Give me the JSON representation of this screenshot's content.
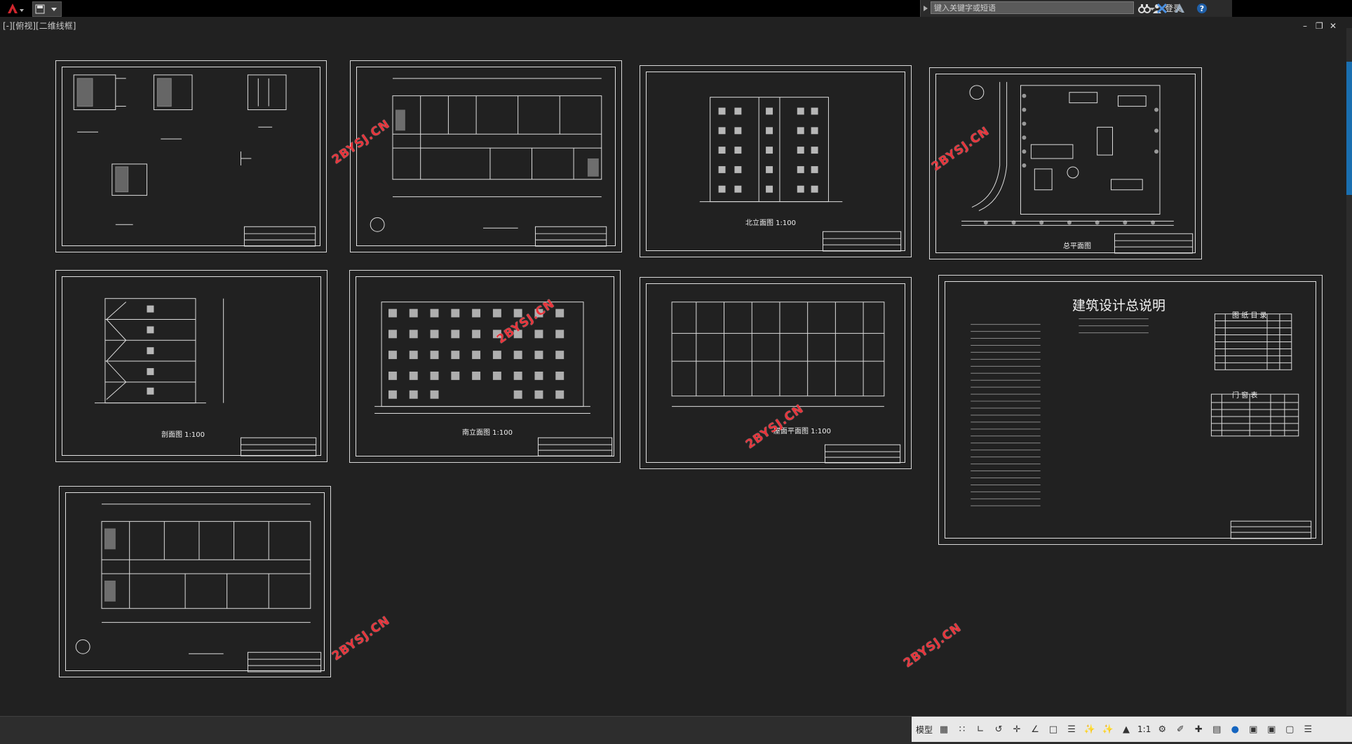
{
  "topbar": {
    "search_placeholder": "键入关键字或短语",
    "login_label": "登录",
    "help_icon": "?"
  },
  "viewport": {
    "label": "[-][俯视][二维线框]"
  },
  "sheets": {
    "s3_title": "北立面图 1:100",
    "s4_title": "总平面图",
    "s5_title": "剖面图 1:100",
    "s6_title": "南立面图 1:100",
    "s7_title": "屋面平面图 1:100",
    "s8_title": "建筑设计总说明",
    "s8_table1": "图 纸 目 录",
    "s8_table2": "门 窗 表"
  },
  "watermark_text": "2BYSJ.CN",
  "statusbar": {
    "model_label": "模型",
    "scale_label": "1:1"
  },
  "colors": {
    "canvas": "#212121",
    "watermark": "#e8333a",
    "accent": "#1a6fb0"
  }
}
